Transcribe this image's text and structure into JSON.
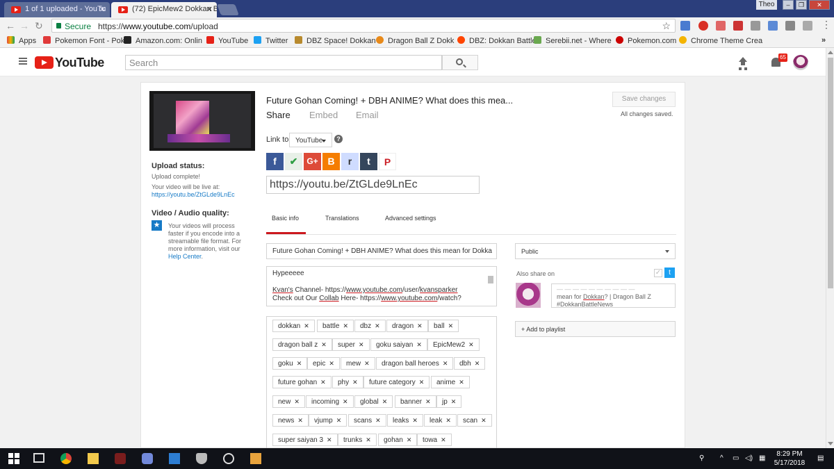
{
  "browser": {
    "tabs": [
      {
        "title": "1 of 1 uploaded - YouTu",
        "close": "✕"
      },
      {
        "title": "(72) EpicMew2 Dokkan B",
        "close": "✕"
      }
    ],
    "user": "Theo",
    "window_controls": [
      "–",
      "❐",
      "✕"
    ],
    "secure_label": "Secure",
    "url_scheme": "https://",
    "url_host": "www.youtube.com",
    "url_path": "/upload",
    "bookmarks": [
      {
        "label": "Apps",
        "color": "#e04b3c"
      },
      {
        "label": "Pokemon Font - Pok",
        "color": "#e03a3a"
      },
      {
        "label": "Amazon.com: Onlin",
        "color": "#222222"
      },
      {
        "label": "YouTube",
        "color": "#e62117"
      },
      {
        "label": "Twitter",
        "color": "#1da1f2"
      },
      {
        "label": "DBZ Space! Dokkan",
        "color": "#b88a2e"
      },
      {
        "label": "Dragon Ball Z Dokk",
        "color": "#e88a1a"
      },
      {
        "label": "DBZ: Dokkan Battle",
        "color": "#ff4500"
      },
      {
        "label": "Serebii.net - Where",
        "color": "#6aa84f"
      },
      {
        "label": "Pokemon.com",
        "color": "#cc0000"
      },
      {
        "label": "Chrome Theme Crea",
        "color": "#f4b400"
      }
    ]
  },
  "masthead": {
    "logo_text": "YouTube",
    "search_placeholder": "Search",
    "notification_count": "65"
  },
  "upload": {
    "status_label": "Upload status:",
    "status_value": "Upload complete!",
    "live_text": "Your video will be live at:",
    "live_url": "https://youtu.be/ZtGLde9LnEc",
    "quality_label": "Video / Audio quality:",
    "quality_text_1": "Your videos will process",
    "quality_text_2": "faster if you encode into a",
    "quality_text_3": "streamable file format. For",
    "quality_text_4": "more information, visit our",
    "quality_link": "Help Center",
    "quality_end": "."
  },
  "video": {
    "title": "Future Gohan Coming! + DBH ANIME? What does this mea...",
    "share_tabs": [
      "Share",
      "Embed",
      "Email"
    ],
    "save_button": "Save changes",
    "saved_status": "All changes saved.",
    "link_to_label": "Link to",
    "link_to_value": "YouTube",
    "help_glyph": "?",
    "short_url": "https://youtu.be/ZtGLde9LnEc",
    "share_buttons": [
      {
        "glyph": "f",
        "color": "#3b5998"
      },
      {
        "glyph": "✔",
        "color": "#34a853"
      },
      {
        "glyph": "G+",
        "color": "#dd4b39"
      },
      {
        "glyph": "B",
        "color": "#f57d00"
      },
      {
        "glyph": "r",
        "color": "#a9c4ff"
      },
      {
        "glyph": "t",
        "color": "#35465c"
      },
      {
        "glyph": "P",
        "color": "#cb2027"
      }
    ]
  },
  "info": {
    "tabs": [
      "Basic info",
      "Translations",
      "Advanced settings"
    ],
    "title_value": "Future Gohan Coming! + DBH ANIME? What does this mean for Dokka",
    "description_line1": "Hypeeeee",
    "description_line2a": "Kvan's",
    "description_line2b": " Channel- https://",
    "description_line2c": "www.youtube.com",
    "description_line2d": "/user/",
    "description_line2e": "kvansparker",
    "description_line3a": "Check out Our ",
    "description_line3b": "Collab",
    "description_line3c": " Here- https://",
    "description_line3d": "www.youtube.com",
    "description_line3e": "/watch?",
    "tags": [
      [
        "dokkan",
        "battle",
        "dbz",
        "dragon",
        "ball"
      ],
      [
        "dragon ball z",
        "super",
        "goku saiyan",
        "EpicMew2"
      ],
      [
        "goku",
        "epic",
        "mew",
        "dragon ball heroes",
        "dbh"
      ],
      [
        "future gohan",
        "phy",
        "future category",
        "anime"
      ],
      [
        "new",
        "incoming",
        "global",
        "banner",
        "jp"
      ],
      [
        "news",
        "vjump",
        "scans",
        "leaks",
        "leak",
        "scan"
      ],
      [
        "super saiyan 3",
        "trunks",
        "gohan",
        "towa"
      ]
    ],
    "tag_remove_glyph": "✕",
    "privacy": "Public",
    "also_share_label": "Also share on",
    "share_text_line1": "mean for ",
    "share_text_link": "Dokkan",
    "share_text_line1b": "? | Dragon Ball Z",
    "share_text_line2": "#DokkanBattleNews",
    "playlist_button": "+ Add to playlist"
  },
  "taskbar": {
    "time": "8:29 PM",
    "date": "5/17/2018"
  }
}
